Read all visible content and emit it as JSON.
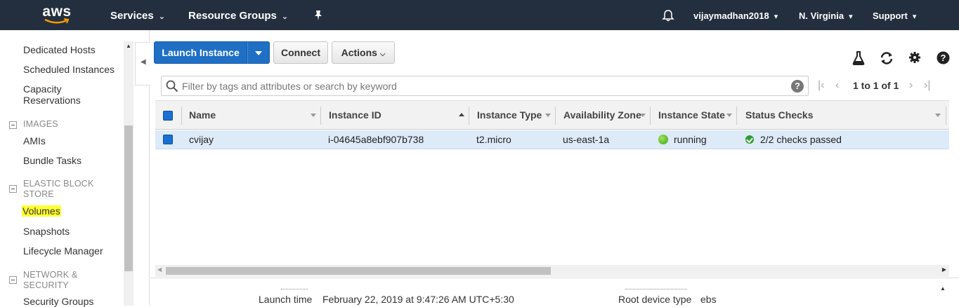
{
  "topnav": {
    "logo_text": "aws",
    "services": "Services",
    "resource_groups": "Resource Groups",
    "user": "vijaymadhan2018",
    "region": "N. Virginia",
    "support": "Support"
  },
  "sidebar": {
    "items": {
      "dedicated_hosts": "Dedicated Hosts",
      "scheduled_instances": "Scheduled Instances",
      "capacity_reservations_1": "Capacity",
      "capacity_reservations_2": "Reservations",
      "amis": "AMIs",
      "bundle_tasks": "Bundle Tasks",
      "volumes": "Volumes",
      "snapshots": "Snapshots",
      "lifecycle_manager": "Lifecycle Manager",
      "security_groups": "Security Groups"
    },
    "sections": {
      "images": "IMAGES",
      "ebs_1": "ELASTIC BLOCK",
      "ebs_2": "STORE",
      "network_1": "NETWORK &",
      "network_2": "SECURITY"
    },
    "highlight_color": "#ffff33"
  },
  "toolbar": {
    "launch": "Launch Instance",
    "connect": "Connect",
    "actions": "Actions"
  },
  "search": {
    "placeholder": "Filter by tags and attributes or search by keyword",
    "pager_text": "1 to 1 of 1"
  },
  "table": {
    "columns": {
      "name": "Name",
      "instance_id": "Instance ID",
      "instance_type": "Instance Type",
      "az": "Availability Zone",
      "state": "Instance State",
      "status": "Status Checks"
    },
    "row": {
      "name": "cvijay",
      "instance_id": "i-04645a8ebf907b738",
      "instance_type": "t2.micro",
      "az": "us-east-1a",
      "state": "running",
      "status": "2/2 checks passed"
    }
  },
  "details": {
    "launch_time_label": "Launch time",
    "launch_time_value": "February 22, 2019 at 9:47:26 AM UTC+5:30",
    "root_device_label": "Root device type",
    "root_device_value": "ebs"
  },
  "colors": {
    "nav_bg": "#232f3e",
    "primary_blue": "#1f6fc5",
    "row_selected": "#ddeaf7",
    "status_green": "#3ea31a"
  }
}
